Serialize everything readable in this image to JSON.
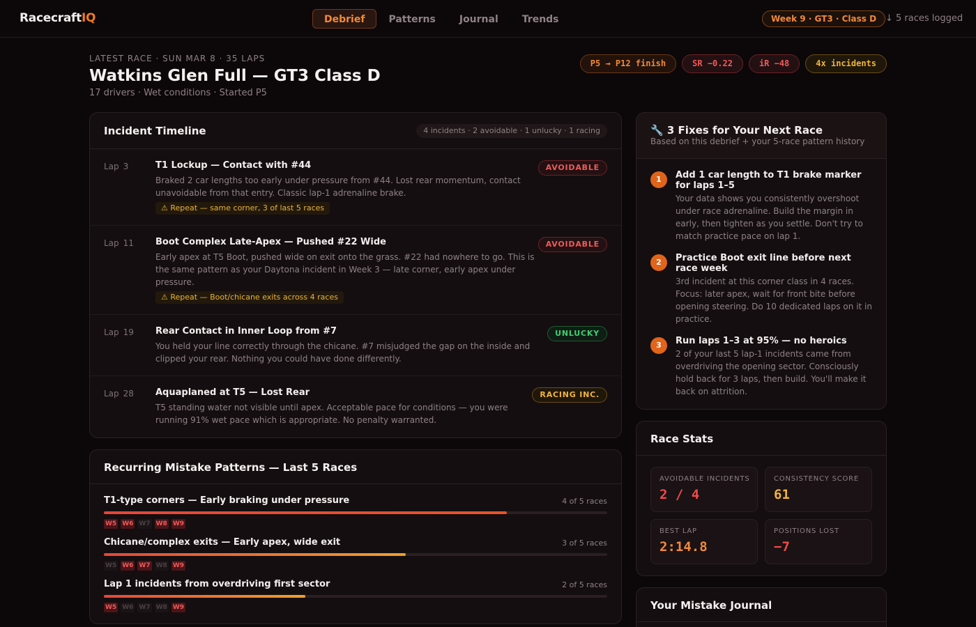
{
  "app": {
    "logo_main": "Racecraft",
    "logo_accent": "IQ"
  },
  "nav": {
    "items": [
      {
        "label": "Debrief",
        "active": true
      },
      {
        "label": "Patterns",
        "active": false
      },
      {
        "label": "Journal",
        "active": false
      },
      {
        "label": "Trends",
        "active": false
      }
    ],
    "week_pill": "Week 9 · GT3 · Class D",
    "races_logged": "↓ 5 races logged"
  },
  "header": {
    "eyebrow": "LATEST RACE · SUN MAR 8 · 35 LAPS",
    "title": "Watkins Glen Full — GT3 Class D",
    "subtitle": "17 drivers · Wet conditions · Started P5",
    "chips": [
      {
        "label": "P5 → P12 finish",
        "tone": "orange"
      },
      {
        "label": "SR −0.22",
        "tone": "red"
      },
      {
        "label": "iR −48",
        "tone": "red"
      },
      {
        "label": "4x incidents",
        "tone": "yellow"
      }
    ]
  },
  "timeline": {
    "title": "Incident Timeline",
    "summary": "4 incidents · 2 avoidable · 1 unlucky · 1 racing",
    "lap_prefix": "Lap",
    "incidents": [
      {
        "lap": "3",
        "title": "T1 Lockup — Contact with #44",
        "desc": "Braked 2 car lengths too early under pressure from #44. Lost rear momentum, contact unavoidable from that entry. Classic lap-1 adrenaline brake.",
        "badge": "AVOIDABLE",
        "badge_type": "avoidable",
        "repeat": "⚠ Repeat — same corner, 3 of last 5 races"
      },
      {
        "lap": "11",
        "title": "Boot Complex Late-Apex — Pushed #22 Wide",
        "desc": "Early apex at T5 Boot, pushed wide on exit onto the grass. #22 had nowhere to go. This is the same pattern as your Daytona incident in Week 3 — late corner, early apex under pressure.",
        "badge": "AVOIDABLE",
        "badge_type": "avoidable",
        "repeat": "⚠ Repeat — Boot/chicane exits across 4 races"
      },
      {
        "lap": "19",
        "title": "Rear Contact in Inner Loop from #7",
        "desc": "You held your line correctly through the chicane. #7 misjudged the gap on the inside and clipped your rear. Nothing you could have done differently.",
        "badge": "UNLUCKY",
        "badge_type": "unlucky",
        "repeat": ""
      },
      {
        "lap": "28",
        "title": "Aquaplaned at T5 — Lost Rear",
        "desc": "T5 standing water not visible until apex. Acceptable pace for conditions — you were running 91% wet pace which is appropriate. No penalty warranted.",
        "badge": "RACING INC.",
        "badge_type": "racing",
        "repeat": ""
      }
    ]
  },
  "patterns": {
    "title": "Recurring Mistake Patterns — Last 5 Races",
    "items": [
      {
        "title": "T1-type corners — Early braking under pressure",
        "count": "4 of 5 races",
        "fraction": 0.8,
        "color": "#e8532a",
        "weeks": [
          {
            "label": "W5",
            "hit": true
          },
          {
            "label": "W6",
            "hit": true
          },
          {
            "label": "W7",
            "hit": false
          },
          {
            "label": "W8",
            "hit": true
          },
          {
            "label": "W9",
            "hit": true
          }
        ]
      },
      {
        "title": "Chicane/complex exits — Early apex, wide exit",
        "count": "3 of 5 races",
        "fraction": 0.6,
        "color": "#f0a02a",
        "weeks": [
          {
            "label": "W5",
            "hit": false
          },
          {
            "label": "W6",
            "hit": true
          },
          {
            "label": "W7",
            "hit": true
          },
          {
            "label": "W8",
            "hit": false
          },
          {
            "label": "W9",
            "hit": true
          }
        ]
      },
      {
        "title": "Lap 1 incidents from overdriving first sector",
        "count": "2 of 5 races",
        "fraction": 0.4,
        "color": "#f0a02a",
        "weeks": [
          {
            "label": "W5",
            "hit": true
          },
          {
            "label": "W6",
            "hit": false
          },
          {
            "label": "W7",
            "hit": false
          },
          {
            "label": "W8",
            "hit": false
          },
          {
            "label": "W9",
            "hit": true
          }
        ]
      }
    ]
  },
  "fixes": {
    "title": "🔧 3 Fixes for Your Next Race",
    "subtitle": "Based on this debrief + your 5-race pattern history",
    "items": [
      {
        "num": "1",
        "title": "Add 1 car length to T1 brake marker for laps 1–5",
        "desc": "Your data shows you consistently overshoot under race adrenaline. Build the margin in early, then tighten as you settle. Don't try to match practice pace on lap 1."
      },
      {
        "num": "2",
        "title": "Practice Boot exit line before next race week",
        "desc": "3rd incident at this corner class in 4 races. Focus: later apex, wait for front bite before opening steering. Do 10 dedicated laps on it in practice."
      },
      {
        "num": "3",
        "title": "Run laps 1–3 at 95% — no heroics",
        "desc": "2 of your last 5 lap-1 incidents came from overdriving the opening sector. Consciously hold back for 3 laps, then build. You'll make it back on attrition."
      }
    ]
  },
  "stats": {
    "title": "Race Stats",
    "items": [
      {
        "label": "AVOIDABLE INCIDENTS",
        "value": "2 / 4",
        "tone": "red"
      },
      {
        "label": "CONSISTENCY SCORE",
        "value": "61",
        "tone": "yellow"
      },
      {
        "label": "BEST LAP",
        "value": "2:14.8",
        "tone": "orange"
      },
      {
        "label": "POSITIONS LOST",
        "value": "−7",
        "tone": "red"
      }
    ]
  },
  "journal": {
    "title": "Your Mistake Journal"
  }
}
